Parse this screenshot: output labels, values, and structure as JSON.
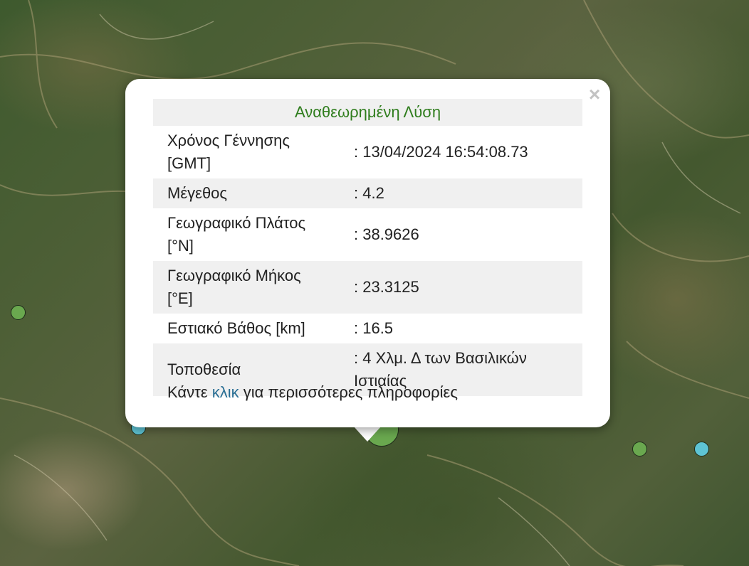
{
  "popup": {
    "title": "Αναθεωρημένη Λύση",
    "close_symbol": "×",
    "rows": [
      {
        "label": "Χρόνος Γέννησης [GMT]",
        "value": ": 13/04/2024 16:54:08.73"
      },
      {
        "label": "Μέγεθος",
        "value": ": 4.2"
      },
      {
        "label": "Γεωγραφικό Πλάτος [°N]",
        "value": ": 38.9626"
      },
      {
        "label": "Γεωγραφικό Μήκος [°E]",
        "value": ": 23.3125"
      },
      {
        "label": "Εστιακό Βάθος [km]",
        "value": ": 16.5"
      },
      {
        "label": "Τοποθεσία",
        "value": ": 4 Χλμ. Δ των Βασιλικών Ιστιαίας"
      }
    ],
    "more_prefix": "Κάντε ",
    "more_link": "κλικ",
    "more_suffix": " για περισσότερες πληροφορίες"
  },
  "map": {
    "marker_colors": {
      "green": "#6aa84f",
      "light_blue": "#5ec4d4"
    }
  }
}
